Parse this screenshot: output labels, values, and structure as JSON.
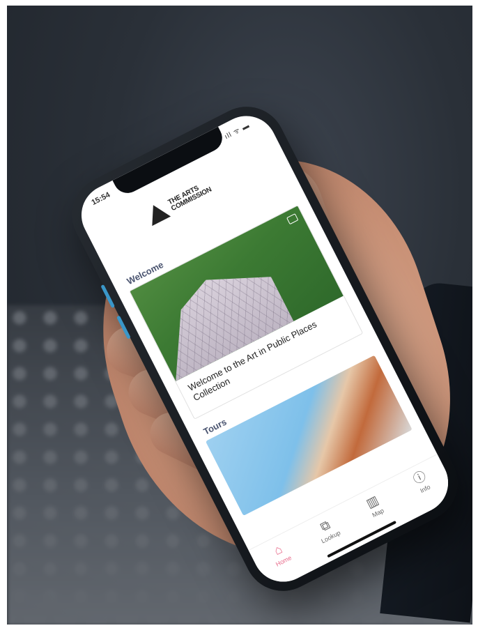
{
  "status_bar": {
    "time": "15:54",
    "icons": "ıll ᯤ ▬"
  },
  "logo": {
    "line1": "THE ARTS",
    "line2": "COMMISSION"
  },
  "sections": {
    "welcome_label": "Welcome",
    "tours_label": "Tours"
  },
  "welcome_card": {
    "title": "Welcome to the Art in Public Places Collection"
  },
  "tabbar": {
    "items": [
      {
        "label": "Home",
        "icon": "house-icon",
        "glyph": "⌂",
        "active": true
      },
      {
        "label": "Lookup",
        "icon": "lookup-icon",
        "glyph": "⧉",
        "active": false
      },
      {
        "label": "Map",
        "icon": "map-icon",
        "glyph": "▥",
        "active": false
      },
      {
        "label": "Info",
        "icon": "info-icon",
        "glyph": "ⓘ",
        "active": false
      }
    ]
  },
  "colors": {
    "accent": "#e86a8a",
    "section_label": "#4a5470"
  }
}
